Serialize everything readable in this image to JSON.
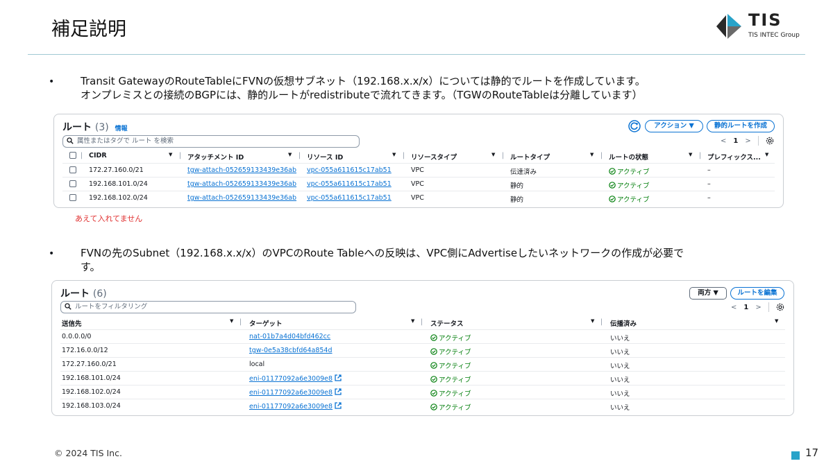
{
  "slide": {
    "title": "補足説明",
    "logo_name": "TIS",
    "logo_sub": "TIS INTEC Group",
    "bullet_char": "•",
    "bullet1_line1": "Transit GatewayのRouteTableにFVNの仮想サブネット（192.168.x.x/x）については静的でルートを作成しています。",
    "bullet1_line2": "オンプレミスとの接続のBGPには、静的ルートがredistributeで流れてきます。（TGWのRouteTableは分離しています）",
    "note": "あえて入れてません",
    "bullet2_line1": "FVNの先のSubnet（192.168.x.x/x）のVPCのRoute Tableへの反映は、VPC側にAdvertiseしたいネットワークの作成が必要で",
    "bullet2_line2": "す。",
    "footer": "© 2024 TIS Inc.",
    "page_number": "17",
    "accent_color": "#29a3c9"
  },
  "tgw_panel": {
    "title": "ルート",
    "count": "(3)",
    "info_link": "情報",
    "action_button": "アクション ▼",
    "create_button": "静的ルートを作成",
    "search_placeholder": "属性またはタグで ルート を検索",
    "pager_prev": "<",
    "pager_page": "1",
    "pager_next": ">",
    "columns": [
      "CIDR",
      "アタッチメント ID",
      "リソース ID",
      "リソースタイプ",
      "ルートタイプ",
      "ルートの状態",
      "プレフィックス..."
    ],
    "rows": [
      {
        "cidr": "172.27.160.0/21",
        "attachment": "tgw-attach-052659133439e36ab",
        "resource": "vpc-055a611615c17ab51",
        "type": "VPC",
        "route_type": "伝達済み",
        "state": "アクティブ",
        "prefix": "–"
      },
      {
        "cidr": "192.168.101.0/24",
        "attachment": "tgw-attach-052659133439e36ab",
        "resource": "vpc-055a611615c17ab51",
        "type": "VPC",
        "route_type": "静的",
        "state": "アクティブ",
        "prefix": "–"
      },
      {
        "cidr": "192.168.102.0/24",
        "attachment": "tgw-attach-052659133439e36ab",
        "resource": "vpc-055a611615c17ab51",
        "type": "VPC",
        "route_type": "静的",
        "state": "アクティブ",
        "prefix": "–"
      }
    ]
  },
  "vpc_panel": {
    "title": "ルート",
    "count": "(6)",
    "both_select": "両方 ▼",
    "edit_button": "ルートを編集",
    "search_placeholder": "ルートをフィルタリング",
    "pager_prev": "<",
    "pager_page": "1",
    "pager_next": ">",
    "columns": [
      "送信先",
      "ターゲット",
      "ステータス",
      "伝播済み"
    ],
    "rows": [
      {
        "dest": "0.0.0.0/0",
        "target": "nat-01b7a4d04bfd462cc",
        "target_link": true,
        "external": false,
        "status": "アクティブ",
        "propagated": "いいえ"
      },
      {
        "dest": "172.16.0.0/12",
        "target": "tgw-0e5a38cbfd64a854d",
        "target_link": true,
        "external": false,
        "status": "アクティブ",
        "propagated": "いいえ"
      },
      {
        "dest": "172.27.160.0/21",
        "target": "local",
        "target_link": false,
        "external": false,
        "status": "アクティブ",
        "propagated": "いいえ"
      },
      {
        "dest": "192.168.101.0/24",
        "target": "eni-01177092a6e3009e8",
        "target_link": true,
        "external": true,
        "status": "アクティブ",
        "propagated": "いいえ"
      },
      {
        "dest": "192.168.102.0/24",
        "target": "eni-01177092a6e3009e8",
        "target_link": true,
        "external": true,
        "status": "アクティブ",
        "propagated": "いいえ"
      },
      {
        "dest": "192.168.103.0/24",
        "target": "eni-01177092a6e3009e8",
        "target_link": true,
        "external": true,
        "status": "アクティブ",
        "propagated": "いいえ"
      }
    ]
  }
}
